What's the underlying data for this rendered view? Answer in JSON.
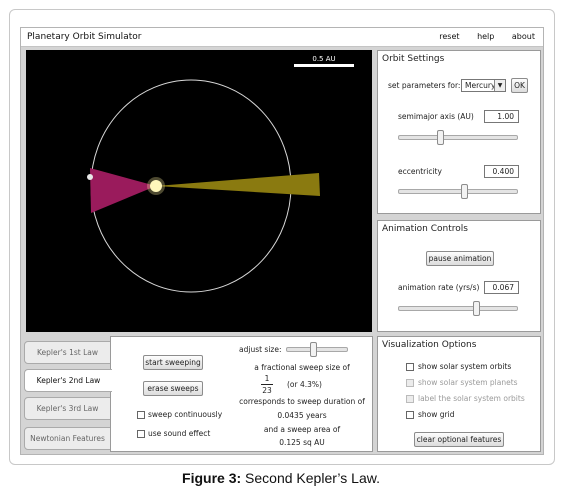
{
  "app": {
    "title": "Planetary Orbit Simulator",
    "menu": [
      "reset",
      "help",
      "about"
    ]
  },
  "simulation": {
    "scale_label": "0.5 AU",
    "colors": {
      "background": "#000000",
      "orbit": "#d8d8d8",
      "sweep_1": "#9a1b5c",
      "sweep_2": "#8a7a10",
      "sun": "#fff9c8"
    }
  },
  "orbit_settings": {
    "title": "Orbit Settings",
    "set_params_label": "set parameters for:",
    "planet_value": "Mercury",
    "ok_label": "OK",
    "semimajor_label": "semimajor axis (AU)",
    "semimajor_value": "1.00",
    "semimajor_slider_fraction": 0.35,
    "eccentricity_label": "eccentricity",
    "eccentricity_value": "0.400",
    "eccentricity_slider_fraction": 0.55
  },
  "animation_controls": {
    "title": "Animation Controls",
    "pause_label": "pause animation",
    "rate_label": "animation rate (yrs/s)",
    "rate_value": "0.067",
    "rate_slider_fraction": 0.65
  },
  "visualization_options": {
    "title": "Visualization Options",
    "options": [
      {
        "label": "show solar system orbits",
        "enabled": true
      },
      {
        "label": "show solar system planets",
        "enabled": false
      },
      {
        "label": "label the solar system orbits",
        "enabled": false
      },
      {
        "label": "show grid",
        "enabled": true
      }
    ],
    "clear_label": "clear optional features"
  },
  "tabs": [
    "Kepler's 1st Law",
    "Kepler's 2nd Law",
    "Kepler's 3rd Law",
    "Newtonian Features"
  ],
  "active_tab": 1,
  "kepler2": {
    "start_label": "start sweeping",
    "erase_label": "erase sweeps",
    "continuous_label": "sweep continuously",
    "sound_label": "use sound effect",
    "adjust_label": "adjust size:",
    "adjust_slider_fraction": 0.45,
    "fraction_intro": "a fractional sweep size of",
    "numerator": "1",
    "denominator": "23",
    "percent": "(or   4.3%)",
    "duration_intro": "corresponds to sweep duration of",
    "duration_value": "0.0435 years",
    "area_intro": "and a sweep area of",
    "area_value": "0.125 sq AU"
  },
  "caption": {
    "label": "Figure 3:",
    "text": "Second Kepler’s Law."
  }
}
